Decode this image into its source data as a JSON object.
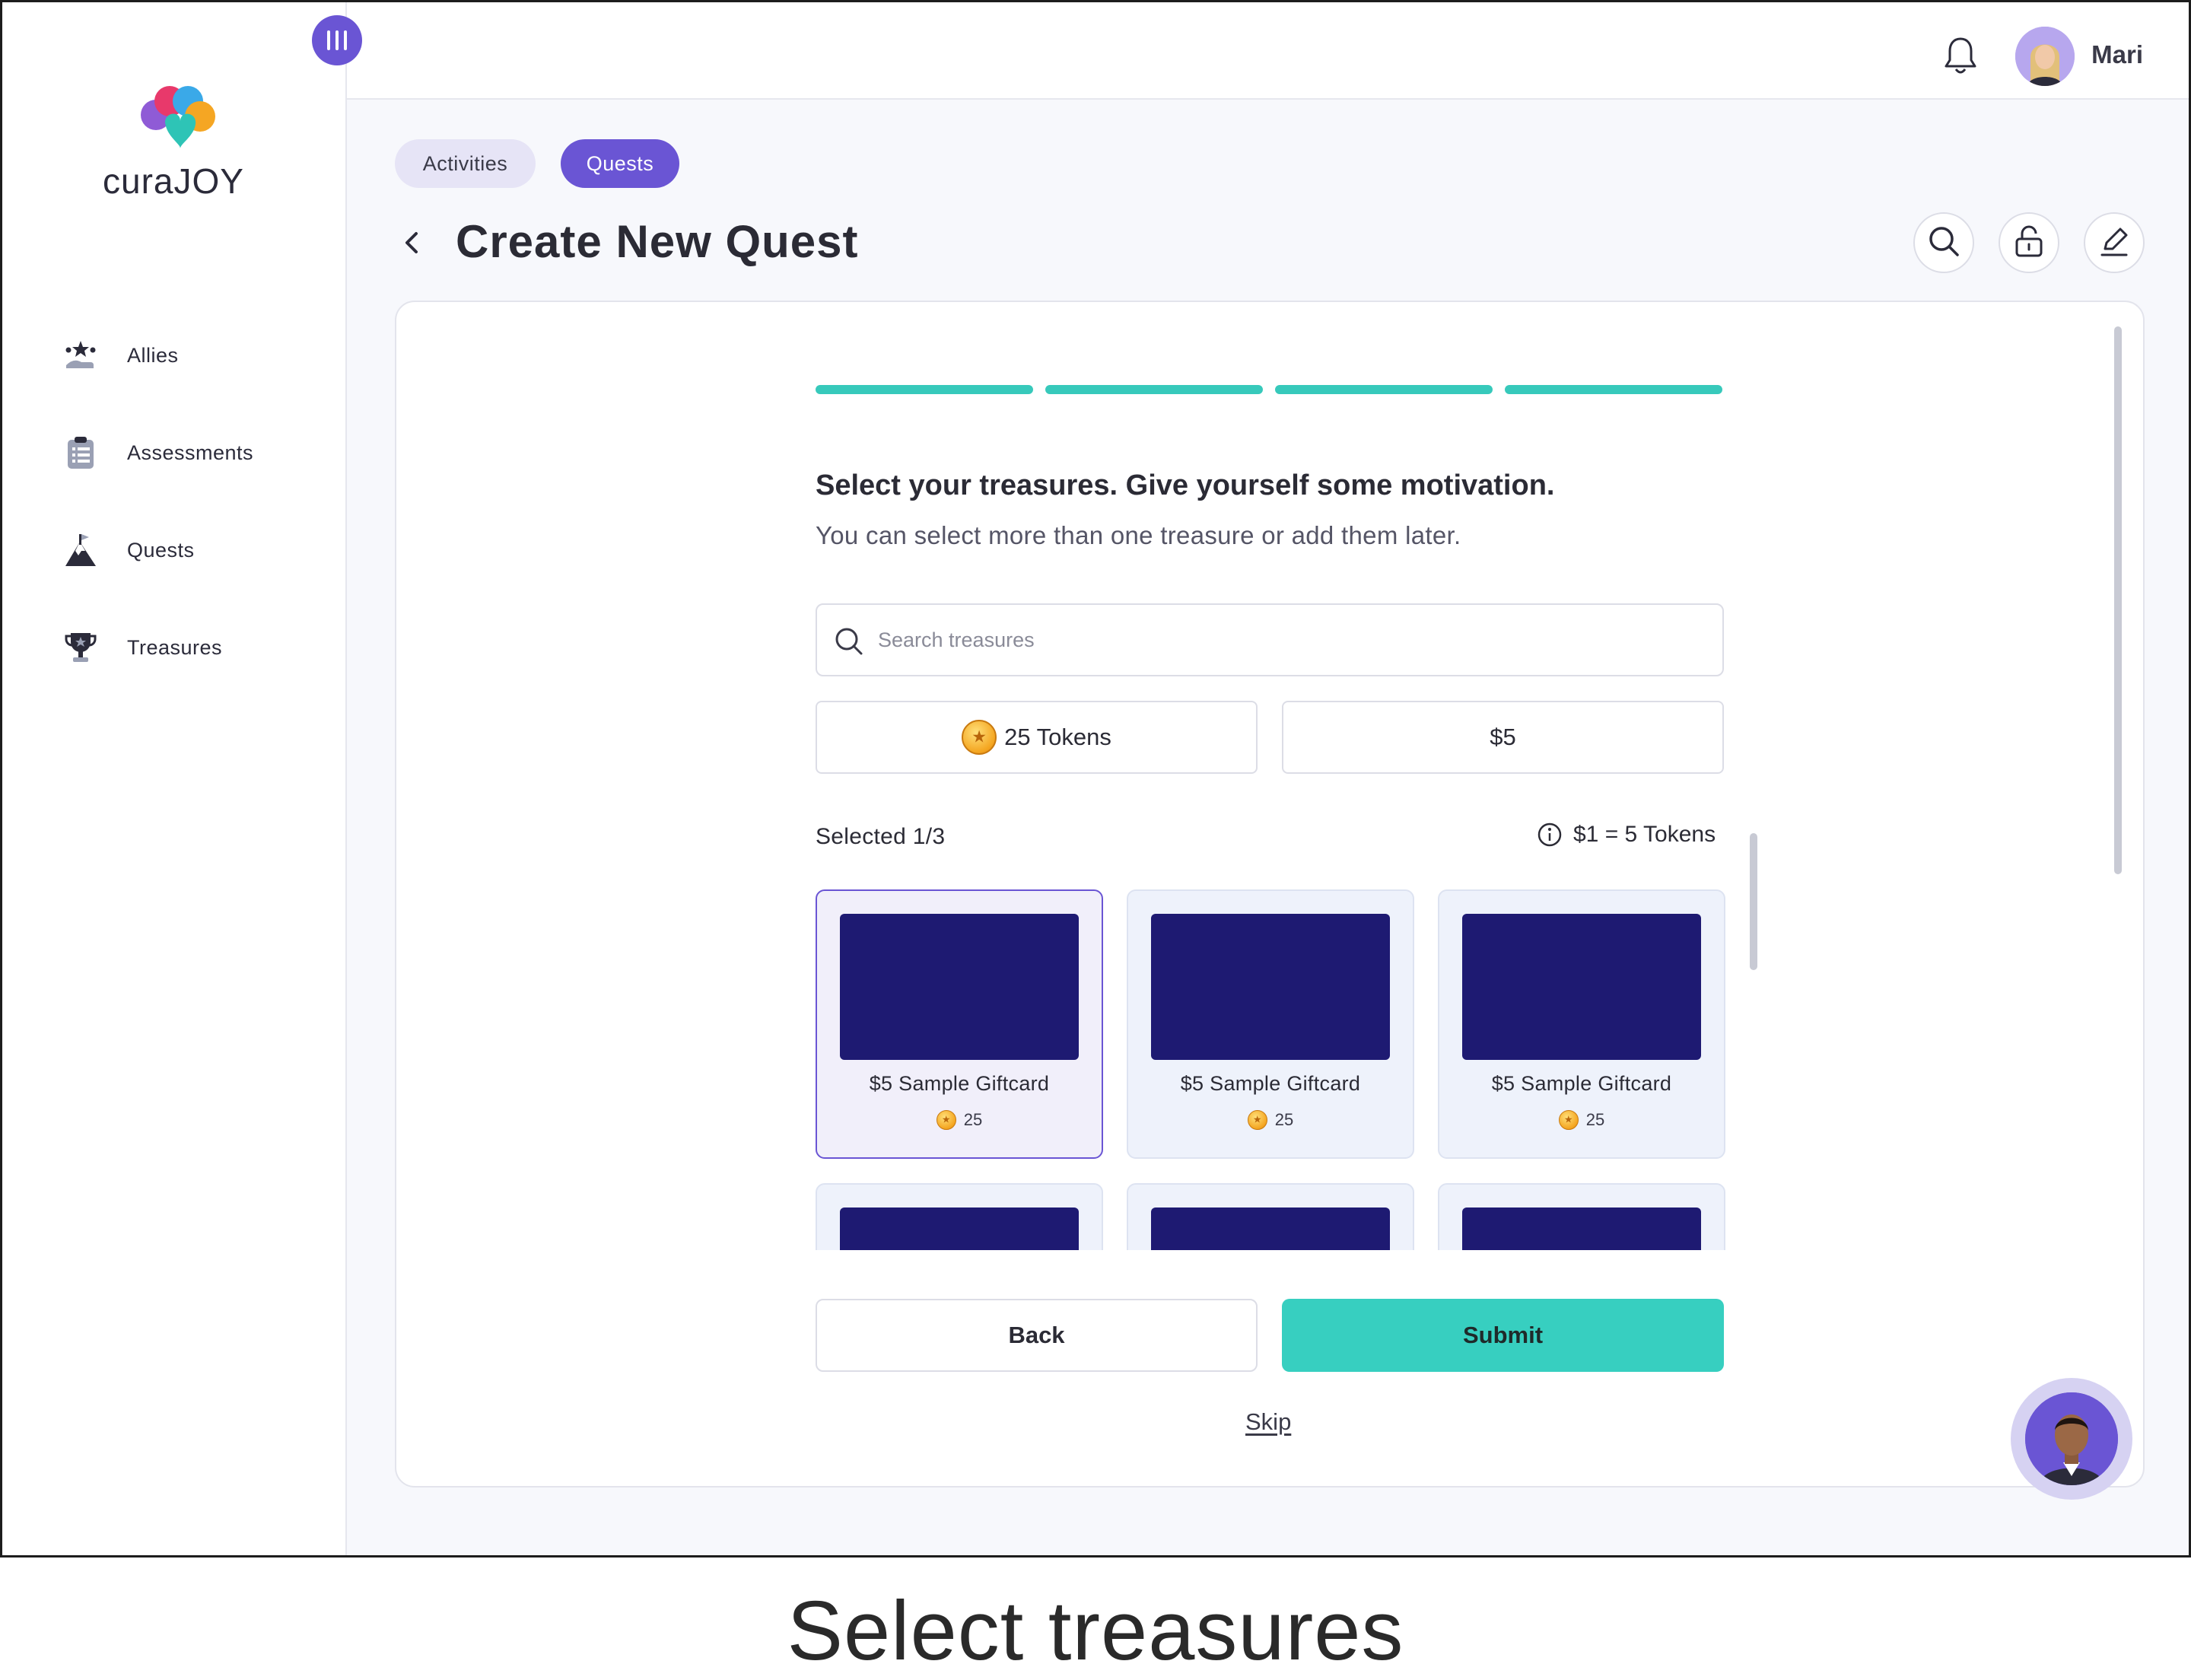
{
  "app": {
    "logo_text": "curaJOY"
  },
  "sidebar": {
    "items": [
      {
        "label": "Allies",
        "icon": "allies-icon"
      },
      {
        "label": "Assessments",
        "icon": "clipboard-icon"
      },
      {
        "label": "Quests",
        "icon": "mountain-flag-icon"
      },
      {
        "label": "Treasures",
        "icon": "trophy-icon"
      }
    ]
  },
  "topbar": {
    "user_name": "Mari"
  },
  "tabs": {
    "activities": "Activities",
    "quests": "Quests"
  },
  "page": {
    "title": "Create New Quest"
  },
  "wizard": {
    "steps_total": 4,
    "steps_completed": 4,
    "heading": "Select your treasures. Give yourself some motivation.",
    "subheading": "You can select more than one treasure or add them later.",
    "search_placeholder": "Search treasures",
    "filters": {
      "tokens": "25 Tokens",
      "dollars": "$5"
    },
    "selected_label": "Selected 1/3",
    "rate_label": "$1 = 5 Tokens",
    "treasures": [
      {
        "name": "$5 Sample Giftcard",
        "cost": "25",
        "selected": true
      },
      {
        "name": "$5 Sample Giftcard",
        "cost": "25",
        "selected": false
      },
      {
        "name": "$5 Sample Giftcard",
        "cost": "25",
        "selected": false
      }
    ],
    "back_label": "Back",
    "submit_label": "Submit",
    "skip_label": "Skip"
  },
  "colors": {
    "accent_purple": "#6a55d4",
    "accent_teal": "#37cfc0",
    "card_image": "#1e1a72"
  },
  "caption": "Select treasures"
}
